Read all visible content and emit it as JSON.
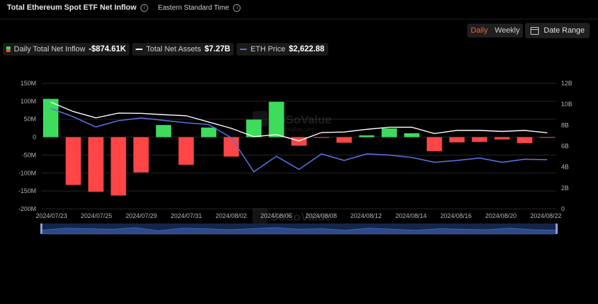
{
  "header": {
    "title": "Total Ethereum Spot ETF Net Inflow",
    "timezone": "Eastern Standard Time"
  },
  "controls": {
    "daily_label": "Daily",
    "weekly_label": "Weekly",
    "active_period": "Daily",
    "date_range_label": "Date Range"
  },
  "legend": {
    "inflow_label": "Daily Total Net Inflow",
    "inflow_value": "-$874.61K",
    "assets_label": "Total Net Assets",
    "assets_value": "$7.27B",
    "eth_label": "ETH Price",
    "eth_value": "$2,622.88"
  },
  "watermark": {
    "brand": "SoSoValue",
    "url": "sosovalue.com"
  },
  "colors": {
    "positive": "#3ddc5c",
    "negative": "#ff4545",
    "assets_line": "#ffffff",
    "eth_line": "#5b6fe0",
    "background": "#000000",
    "accent": "#ff5b3a"
  },
  "chart_data": {
    "type": "bar",
    "dates": [
      "2024/07/23",
      "2024/07/24",
      "2024/07/25",
      "2024/07/26",
      "2024/07/29",
      "2024/07/30",
      "2024/07/31",
      "2024/08/01",
      "2024/08/02",
      "2024/08/05",
      "2024/08/06",
      "2024/08/07",
      "2024/08/08",
      "2024/08/09",
      "2024/08/12",
      "2024/08/13",
      "2024/08/14",
      "2024/08/15",
      "2024/08/16",
      "2024/08/19",
      "2024/08/20",
      "2024/08/21",
      "2024/08/22"
    ],
    "x_tick_labels": [
      "2024/07/23",
      "2024/07/25",
      "2024/07/29",
      "2024/07/31",
      "2024/08/02",
      "2024/08/06",
      "2024/08/08",
      "2024/08/12",
      "2024/08/14",
      "2024/08/16",
      "2024/08/20",
      "2024/08/22"
    ],
    "series": [
      {
        "name": "Daily Total Net Inflow",
        "axis": "left",
        "unit": "USD",
        "values": [
          106600000,
          -133300000,
          -152300000,
          -162700000,
          -98300000,
          33700000,
          -77200000,
          26700000,
          -54200000,
          48800000,
          98400000,
          -23700000,
          -2000000,
          -15500000,
          4900000,
          24300000,
          10800000,
          -39200000,
          -14700000,
          -13500000,
          -6500000,
          -16700000,
          -874610
        ]
      },
      {
        "name": "Total Net Assets",
        "axis": "right",
        "unit": "USD",
        "values": [
          10200000000,
          9300000000,
          8700000000,
          9150000000,
          9130000000,
          9000000000,
          8900000000,
          8300000000,
          7700000000,
          6900000000,
          7100000000,
          6500000000,
          7300000000,
          7350000000,
          7600000000,
          7800000000,
          7800000000,
          7200000000,
          7500000000,
          7500000000,
          7400000000,
          7500000000,
          7270000000
        ]
      },
      {
        "name": "ETH Price",
        "axis": "hidden",
        "unit": "USD",
        "values": [
          3480,
          3340,
          3170,
          3275,
          3320,
          3280,
          3240,
          3210,
          2990,
          2420,
          2680,
          2460,
          2720,
          2610,
          2720,
          2700,
          2660,
          2580,
          2610,
          2650,
          2580,
          2630,
          2622.88
        ]
      }
    ],
    "y_left": {
      "min": -200000000,
      "max": 150000000,
      "ticks": [
        "150M",
        "100M",
        "50M",
        "0",
        "-50M",
        "-100M",
        "-150M",
        "-200M"
      ]
    },
    "y_right": {
      "min": 0,
      "max": 12000000000,
      "ticks": [
        "12B",
        "10B",
        "8B",
        "6B",
        "4B",
        "2B",
        "0"
      ]
    },
    "eth_range": [
      1800,
      3900
    ],
    "navigator_values": [
      0.35,
      0.55,
      0.5,
      0.45,
      0.6,
      0.3,
      0.55,
      0.5,
      0.4,
      0.5,
      0.6,
      0.45,
      0.5,
      0.35,
      0.55,
      0.45,
      0.35,
      0.5,
      0.45,
      0.4,
      0.55,
      0.4,
      0.35
    ],
    "grid": "horizontal",
    "legend_position": "top-left"
  }
}
